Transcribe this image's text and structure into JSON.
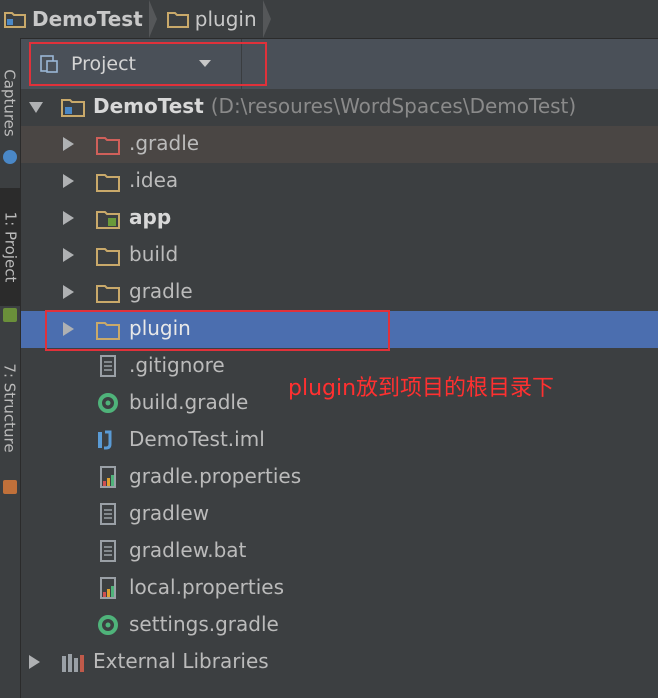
{
  "breadcrumb": [
    {
      "label": "DemoTest",
      "icon": "project-folder-icon"
    },
    {
      "label": "plugin",
      "icon": "folder-icon"
    }
  ],
  "toolstrip": {
    "captures_label": "Captures",
    "project_label": "1: Project",
    "structure_label": "7: Structure"
  },
  "project_panel": {
    "view_label": "Project"
  },
  "tree": {
    "root_name": "DemoTest",
    "root_path": "(D:\\resoures\\WordSpaces\\DemoTest)",
    "items": [
      {
        "label": ".gradle",
        "type": "folder-excluded"
      },
      {
        "label": ".idea",
        "type": "folder"
      },
      {
        "label": "app",
        "type": "module"
      },
      {
        "label": "build",
        "type": "folder"
      },
      {
        "label": "gradle",
        "type": "folder"
      },
      {
        "label": "plugin",
        "type": "folder"
      },
      {
        "label": ".gitignore",
        "type": "text-file"
      },
      {
        "label": "build.gradle",
        "type": "gradle-file"
      },
      {
        "label": "DemoTest.iml",
        "type": "iml-file"
      },
      {
        "label": "gradle.properties",
        "type": "properties-file"
      },
      {
        "label": "gradlew",
        "type": "text-file"
      },
      {
        "label": "gradlew.bat",
        "type": "text-file"
      },
      {
        "label": "local.properties",
        "type": "properties-file"
      },
      {
        "label": "settings.gradle",
        "type": "gradle-file"
      }
    ],
    "external_libraries": "External Libraries"
  },
  "annotation": "plugin放到项目的根目录下",
  "colors": {
    "background": "#3c3f41",
    "selection": "#4b6eaf",
    "folder": "#c9a96a",
    "annotation": "#ff3030"
  }
}
